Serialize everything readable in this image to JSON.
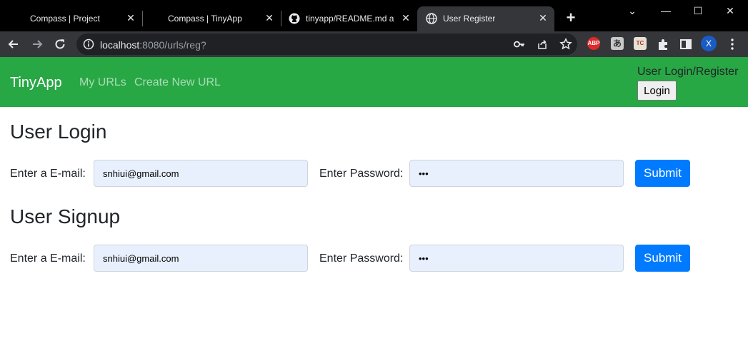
{
  "browser": {
    "tabs": [
      {
        "title": "Compass | Project",
        "active": false
      },
      {
        "title": "Compass | TinyApp",
        "active": false
      },
      {
        "title": "tinyapp/README.md at",
        "active": false
      },
      {
        "title": "User Register",
        "active": true
      }
    ],
    "new_tab": "+",
    "window_controls": {
      "chevron": "⌄",
      "minimize": "—",
      "maximize": "☐",
      "close": "✕"
    },
    "url": {
      "host": "localhost",
      "rest": ":8080/urls/reg?"
    },
    "extensions": {
      "abp": "ABP",
      "tc": "TC"
    },
    "profile_initial": "X"
  },
  "navbar": {
    "brand": "TinyApp",
    "links": [
      "My URLs",
      "Create New URL"
    ],
    "auth_label": "User Login/Register",
    "login_button": "Login",
    "color": "#28a745"
  },
  "login": {
    "title": "User Login",
    "email_label": "Enter a E-mail:",
    "email_value": "snhiui@gmail.com",
    "password_label": "Enter Password:",
    "password_value": "123",
    "submit": "Submit"
  },
  "signup": {
    "title": "User Signup",
    "email_label": "Enter a E-mail:",
    "email_value": "snhiui@gmail.com",
    "password_label": "Enter Password:",
    "password_value": "123",
    "submit": "Submit"
  }
}
